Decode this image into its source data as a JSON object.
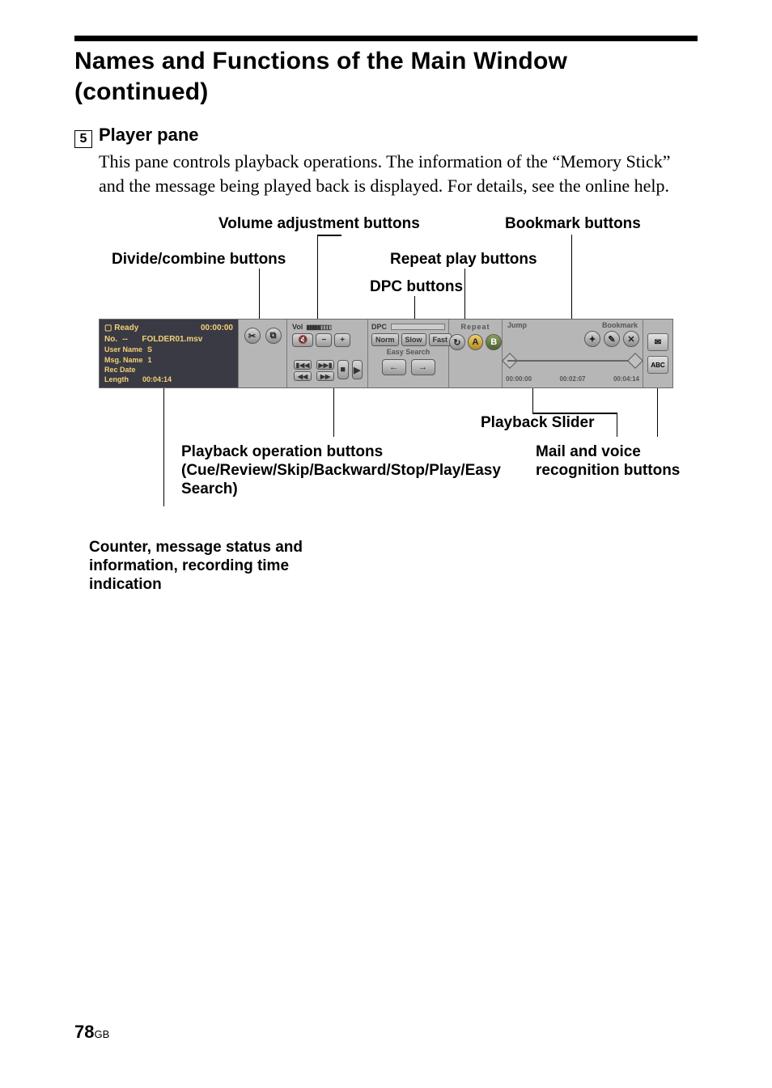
{
  "page": {
    "title": "Names and Functions of the Main Window (continued)",
    "item_number": "5",
    "item_title": "Player pane",
    "body": "This pane controls playback operations.  The information of the “Memory Stick” and the message being played back is displayed.   For details, see the online help.",
    "footer_page": "78",
    "footer_suffix": "GB"
  },
  "callouts": {
    "volume": "Volume adjustment buttons",
    "bookmark": "Bookmark buttons",
    "divide": "Divide/combine buttons",
    "repeat": "Repeat play buttons",
    "dpc": "DPC buttons",
    "slider": "Playback Slider",
    "playback_ops": "Playback operation buttons (Cue/Review/Skip/Backward/Stop/Play/Easy Search)",
    "mail": "Mail and voice recognition buttons",
    "counter": "Counter, message status and information, recording time indication"
  },
  "player": {
    "status": "Ready",
    "counter": "00:00:00",
    "no_label": "No.",
    "no_value": "--",
    "folder": "FOLDER01.msv",
    "username_label": "User Name",
    "username_value": "S",
    "msgname_label": "Msg. Name",
    "msgname_value": "1",
    "recdate_label": "Rec Date",
    "length_label": "Length",
    "length_value": "00:04:14",
    "vol_label": "Vol",
    "dpc_label": "DPC",
    "dpc_norm": "Norm",
    "dpc_slow": "Slow",
    "dpc_fast": "Fast",
    "easy_search": "Easy Search",
    "repeat_label": "Repeat",
    "repeat_a": "A",
    "repeat_b": "B",
    "jump_label": "Jump",
    "bookmark_label": "Bookmark",
    "slider_start": "00:00:00",
    "slider_mid": "00:02:07",
    "slider_end": "00:04:14",
    "mail_abc": "ABC"
  }
}
